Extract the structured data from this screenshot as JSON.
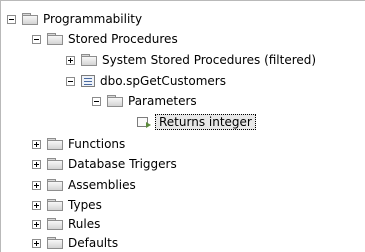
{
  "tree": {
    "programmability": "Programmability",
    "stored_procedures": "Stored Procedures",
    "system_stored_procedures": "System Stored Procedures (filtered)",
    "sp_get_customers": "dbo.spGetCustomers",
    "parameters": "Parameters",
    "returns_integer": "Returns integer",
    "functions": "Functions",
    "database_triggers": "Database Triggers",
    "assemblies": "Assemblies",
    "types": "Types",
    "rules": "Rules",
    "defaults": "Defaults"
  },
  "icons": {
    "folder": "folder-icon",
    "procedure": "stored-procedure-icon",
    "parameter": "return-value-icon",
    "expand": "plus-box-icon",
    "collapse": "minus-box-icon"
  }
}
